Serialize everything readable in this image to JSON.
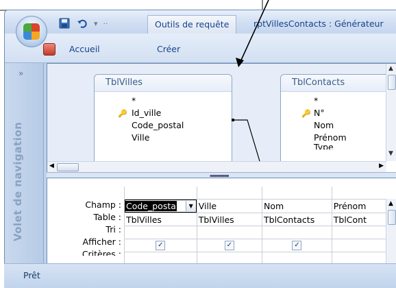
{
  "qat": {
    "context_tab": "Outils de requête",
    "window_title": "rptVillesContacts : Générateur"
  },
  "ribbon": {
    "tabs": [
      "Accueil",
      "Créer"
    ]
  },
  "nav": {
    "chevron": "»",
    "label": "Volet de navigation"
  },
  "tables": [
    {
      "name": "TblVilles",
      "fields": [
        "*",
        "Id_ville",
        "Code_postal",
        "Ville"
      ],
      "key_field_index": 1
    },
    {
      "name": "TblContacts",
      "fields": [
        "*",
        "N°",
        "Nom",
        "Prénom",
        "Type"
      ],
      "key_field_index": 1
    }
  ],
  "grid": {
    "row_labels": [
      "Champ :",
      "Table :",
      "Tri :",
      "Afficher :",
      "Critères :"
    ],
    "columns": [
      {
        "field": "Code_posta",
        "table": "TblVilles",
        "sort": "",
        "show": true,
        "selected": true
      },
      {
        "field": "Ville",
        "table": "TblVilles",
        "sort": "",
        "show": true
      },
      {
        "field": "Nom",
        "table": "TblContacts",
        "sort": "",
        "show": true
      },
      {
        "field": "Prénom",
        "table": "TblCont",
        "sort": "",
        "show": false
      }
    ]
  },
  "status": {
    "text": "Prêt"
  }
}
